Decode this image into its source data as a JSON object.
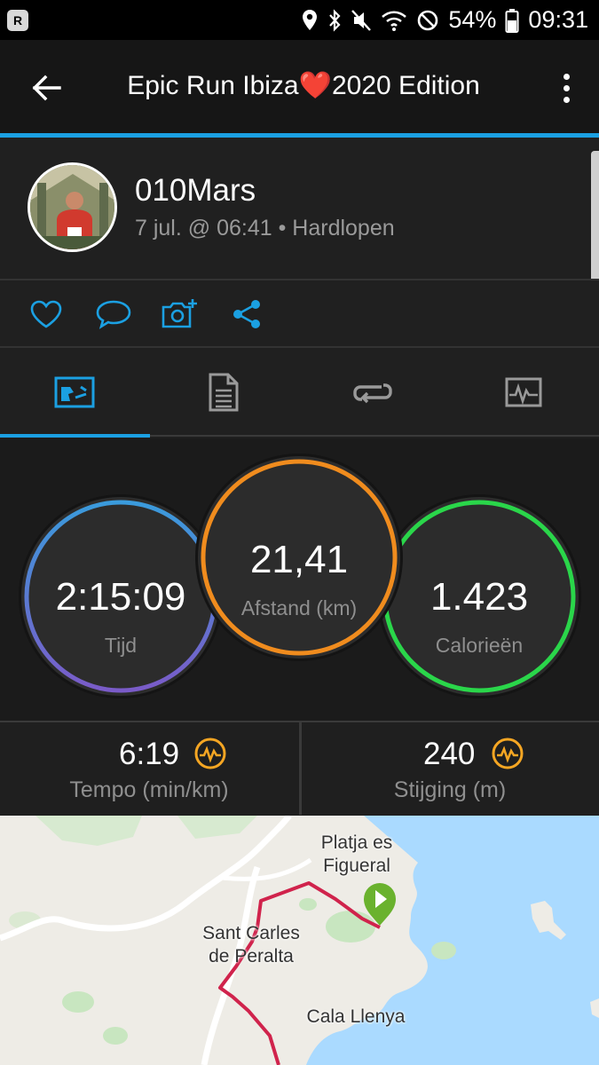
{
  "status_bar": {
    "battery": "54%",
    "time": "09:31",
    "icons": [
      "location-icon",
      "bluetooth-icon",
      "mute-icon",
      "wifi-icon",
      "do-not-disturb-icon",
      "battery-icon"
    ]
  },
  "app_bar": {
    "title_before": "Epic Run Ibiza",
    "title_heart": "❤️",
    "title_after": "2020 Edition"
  },
  "profile": {
    "username": "010Mars",
    "meta": "7 jul. @ 06:41 • Hardlopen"
  },
  "actions": [
    "like-icon",
    "comment-icon",
    "add-photo-icon",
    "share-icon"
  ],
  "tabs": [
    "overview-tab",
    "details-tab",
    "laps-tab",
    "charts-tab"
  ],
  "stats": {
    "time": {
      "value": "2:15:09",
      "label": "Tijd",
      "color_top": "#3a9bdc",
      "color_bottom": "#7a5bc8"
    },
    "distance": {
      "value": "21,41",
      "label": "Afstand (km)",
      "color": "#f08c1e"
    },
    "calories": {
      "value": "1.423",
      "label": "Calorieën",
      "color": "#2ad64a"
    }
  },
  "metrics": {
    "pace": {
      "value": "6:19",
      "label": "Tempo (min/km)"
    },
    "ascent": {
      "value": "240",
      "label": "Stijging (m)"
    },
    "icon_color": "#f5a623"
  },
  "map": {
    "labels": {
      "platja": "Platja es\nFigueral",
      "sant_carles": "Sant Carles\nde Peralta",
      "cala": "Cala Llenya"
    },
    "route_color": "#d0234c",
    "start_marker_color": "#6ab22e",
    "water_color": "#aadaff"
  }
}
